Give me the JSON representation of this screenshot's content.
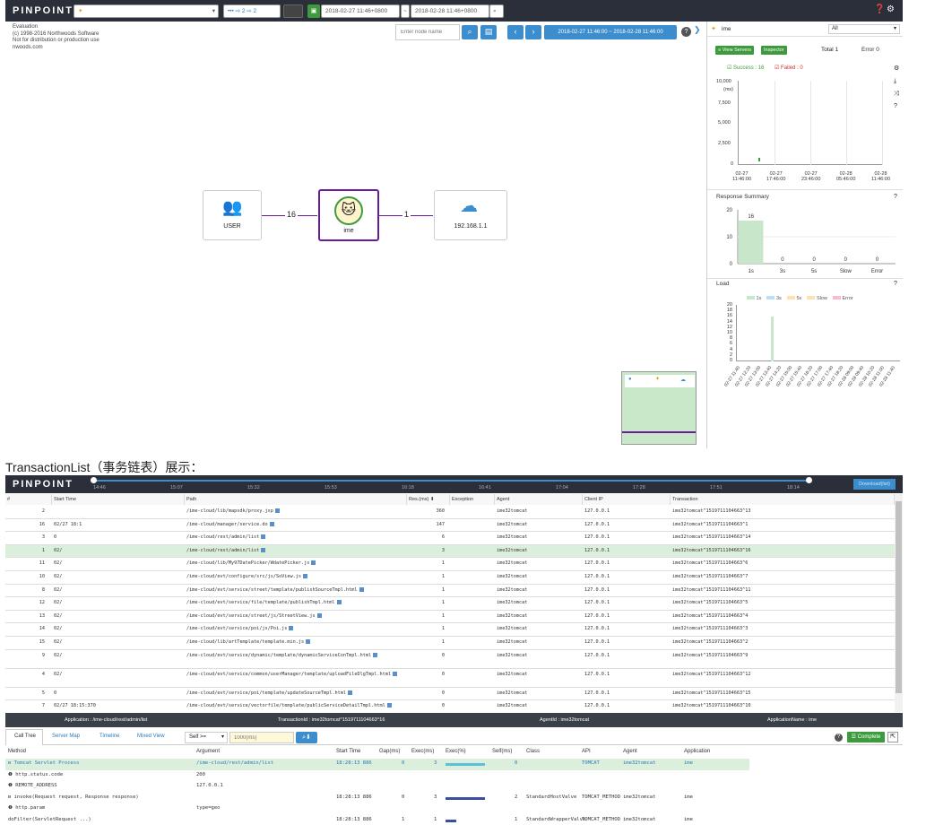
{
  "app": {
    "logo": "PINPOINT",
    "logo2": "PINPOINT"
  },
  "top_header": {
    "app_select": "",
    "depth": "••• ⇨ 2  ⇨ 2",
    "from_time": "2018-02-27 11:46+0800",
    "to_time": "2018-02-28 11:46+0800",
    "sep": "~"
  },
  "watermark": [
    "Evaluation",
    "(c) 1998-2016 Northwoods Software",
    "Not for distribution or production use",
    "nwoods.com"
  ],
  "toolbar": {
    "node_placeholder": "Enter node name",
    "range": "2018-02-27 11:46:00 ~ 2018-02-28 11:46:00"
  },
  "servermap": {
    "nodes": {
      "user": "USER",
      "app": "ime",
      "unknown": "192.168.1.1"
    },
    "edges": {
      "user_app": "16",
      "app_unknown": "1"
    }
  },
  "right": {
    "app_name": "ime",
    "agent_select": "All",
    "view_servers": "≡ View Servers",
    "inspector": "Inspector",
    "total": "Total 1",
    "error": "Error 0",
    "legend_success": "Success : 16",
    "legend_failed": "Failed : 0",
    "scatter": {
      "y_ticks": [
        "10,000",
        "(ms)",
        "7,500",
        "5,000",
        "2,500",
        "0"
      ],
      "x_ticks": [
        [
          "02-27",
          "11:46:00"
        ],
        [
          "02-27",
          "17:46:00"
        ],
        [
          "02-27",
          "23:46:00"
        ],
        [
          "02-28",
          "05:46:00"
        ],
        [
          "02-28",
          "11:46:00"
        ]
      ]
    },
    "response_title": "Response Summary",
    "load_title": "Load",
    "load_legend": [
      "1s",
      "3s",
      "5s",
      "Slow",
      "Error"
    ],
    "load_y": [
      "20",
      "18",
      "16",
      "14",
      "12",
      "10",
      "8",
      "6",
      "4",
      "2",
      "0"
    ],
    "load_x": [
      "02-27 11:40",
      "02-27 12:20",
      "02-27 13:00",
      "02-27 13:40",
      "02-27 14:20",
      "02-27 15:00",
      "02-27 15:40",
      "02-27 16:20",
      "02-27 17:00",
      "02-27 17:40",
      "02-27 18:20",
      "02-28 09:00",
      "02-28 09:40",
      "02-28 10:20",
      "02-28 11:00",
      "02-28 11:40"
    ]
  },
  "chart_data": {
    "type": "bar",
    "title": "Response Summary",
    "categories": [
      "1s",
      "3s",
      "5s",
      "Slow",
      "Error"
    ],
    "values": [
      16,
      0,
      0,
      0,
      0
    ],
    "ylim": [
      0,
      20
    ],
    "y_ticks": [
      "20",
      "10",
      "0"
    ],
    "colors": [
      "#c8e6c9",
      "#bbdefb",
      "#ffe0b2",
      "#f8bbd0",
      "#f8bbd0"
    ]
  },
  "caption": "TransactionList（事务链表）展示：",
  "timeline": {
    "ticks": [
      "14:46",
      "15:07",
      "15:32",
      "15:53",
      "16:18",
      "16:41",
      "17:04",
      "17:28",
      "17:51",
      "18:14"
    ],
    "download": "Download(list)"
  },
  "table": {
    "headers": [
      "#",
      "Start Time",
      "Path",
      "Res.(ms) ⬇",
      "Exception",
      "Agent",
      "Client IP",
      "Transaction"
    ],
    "rows": [
      [
        "2",
        "",
        "/ime-cloud/lib/mapsdk/proxy.jsp",
        "360",
        "",
        "ime32tomcat",
        "127.0.0.1",
        "ime32tomcat^1519711104663^13"
      ],
      [
        "16",
        "02/27 18:1",
        "/ime-cloud/manager/service.do",
        "147",
        "",
        "ime32tomcat",
        "127.0.0.1",
        "ime32tomcat^1519711104663^1"
      ],
      [
        "3",
        "0",
        "/ime-cloud/rest/admin/list",
        "6",
        "",
        "ime32tomcat",
        "127.0.0.1",
        "ime32tomcat^1519711104663^14"
      ],
      [
        "1",
        "02/",
        "/ime-cloud/rest/admin/list",
        "3",
        "",
        "ime32tomcat",
        "127.0.0.1",
        "ime32tomcat^1519711104663^16"
      ],
      [
        "11",
        "02/",
        "/ime-cloud/lib/My97DatePicker/WdatePicker.js",
        "1",
        "",
        "ime32tomcat",
        "127.0.0.1",
        "ime32tomcat^1519711104663^6"
      ],
      [
        "10",
        "02/",
        "/ime-cloud/evt/configure/src/js/SoView.js",
        "1",
        "",
        "ime32tomcat",
        "127.0.0.1",
        "ime32tomcat^1519711104663^7"
      ],
      [
        "8",
        "02/",
        "/ime-cloud/evt/service/street/template/publishSourceTmpl.html",
        "1",
        "",
        "ime32tomcat",
        "127.0.0.1",
        "ime32tomcat^1519711104663^11"
      ],
      [
        "12",
        "02/",
        "/ime-cloud/evt/service/file/template/publishTmpl.html",
        "1",
        "",
        "ime32tomcat",
        "127.0.0.1",
        "ime32tomcat^1519711104663^5"
      ],
      [
        "13",
        "02/",
        "/ime-cloud/evt/service/street/js/StreetView.js",
        "1",
        "",
        "ime32tomcat",
        "127.0.0.1",
        "ime32tomcat^1519711104663^4"
      ],
      [
        "14",
        "02/",
        "/ime-cloud/evt/service/poi/js/Poi.js",
        "1",
        "",
        "ime32tomcat",
        "127.0.0.1",
        "ime32tomcat^1519711104663^3"
      ],
      [
        "15",
        "02/",
        "/ime-cloud/lib/artTemplate/template.min.js",
        "1",
        "",
        "ime32tomcat",
        "127.0.0.1",
        "ime32tomcat^1519711104663^2"
      ],
      [
        "9",
        "02/",
        "/ime-cloud/evt/service/dynamic/template/dynamicServiceConTmpl.html",
        "0",
        "",
        "ime32tomcat",
        "127.0.0.1",
        "ime32tomcat^1519711104663^9"
      ],
      [
        "4",
        "02/",
        "/ime-cloud/evt/service/common/userManager/template/uploadFileDlgTmpl.html",
        "0",
        "",
        "ime32tomcat",
        "127.0.0.1",
        "ime32tomcat^1519711104663^12"
      ],
      [
        "5",
        "0",
        "/ime-cloud/evt/service/poi/template/updateSourceTmpl.html",
        "0",
        "",
        "ime32tomcat",
        "127.0.0.1",
        "ime32tomcat^1519711104663^15"
      ],
      [
        "7",
        "02/27 18:15:370",
        "/ime-cloud/evt/service/vectorfile/template/publicServiceDetailTmpl.html",
        "0",
        "",
        "ime32tomcat",
        "127.0.0.1",
        "ime32tomcat^1519711104663^10"
      ]
    ]
  },
  "info": {
    "application": "Application : /ime-cloud/rest/admin/list",
    "txid": "TransactionId : ime32tomcat^1519711104663^16",
    "agentid": "AgentId : ime32tomcat",
    "appname": "ApplicationName : ime"
  },
  "tabs": {
    "call_tree": "Call Tree",
    "server_map": "Server Map",
    "timeline": "Timeline",
    "mixed_view": "Mixed View",
    "self": "Self >=",
    "self_placeholder": "1000(ms)",
    "complete": "☰ Complete"
  },
  "calltree": {
    "headers": [
      "Method",
      "Argument",
      "Start Time",
      "Gap(ms)",
      "Exec(ms)",
      "Exec(%)",
      "Self(ms)",
      "Class",
      "API",
      "Agent",
      "Application"
    ],
    "rows": [
      {
        "method": "⊟ Tomcat Servlet Process",
        "arg": "/ime-cloud/rest/admin/list",
        "start": "18:28:13 886",
        "gap": "0",
        "exec": "3",
        "self": "0",
        "cls": "",
        "api": "TOMCAT",
        "agent": "ime32tomcat",
        "app": "ime"
      },
      {
        "method": "   ❶ http.status.code",
        "arg": "200",
        "start": "",
        "gap": "",
        "exec": "",
        "self": "",
        "cls": "",
        "api": "",
        "agent": "",
        "app": ""
      },
      {
        "method": "   ❶ REMOTE_ADDRESS",
        "arg": "127.0.0.1",
        "start": "",
        "gap": "",
        "exec": "",
        "self": "",
        "cls": "",
        "api": "",
        "agent": "",
        "app": ""
      },
      {
        "method": "⊟ invoke(Request request, Response response)",
        "arg": "",
        "start": "18:28:13 886",
        "gap": "0",
        "exec": "3",
        "self": "2",
        "cls": "StandardHostValve",
        "api": "TOMCAT_METHOD",
        "agent": "ime32tomcat",
        "app": "ime"
      },
      {
        "method": "   ❶ http.param",
        "arg": "type=geo",
        "start": "",
        "gap": "",
        "exec": "",
        "self": "",
        "cls": "",
        "api": "",
        "agent": "",
        "app": ""
      },
      {
        "method": "     doFilter(ServletRequest ...)",
        "arg": "",
        "start": "18:28:13 886",
        "gap": "1",
        "exec": "1",
        "self": "1",
        "cls": "StandardWrapperValve",
        "api": "TOMCAT_METHOD",
        "agent": "ime32tomcat",
        "app": "ime"
      }
    ]
  },
  "colors": {
    "header_bg": "#2a2f3a",
    "accent": "#3c8dcd",
    "green": "#3d9b3d",
    "purple": "#6a1b9a",
    "success": "#3d9b3d",
    "failed": "#d32f2f"
  }
}
